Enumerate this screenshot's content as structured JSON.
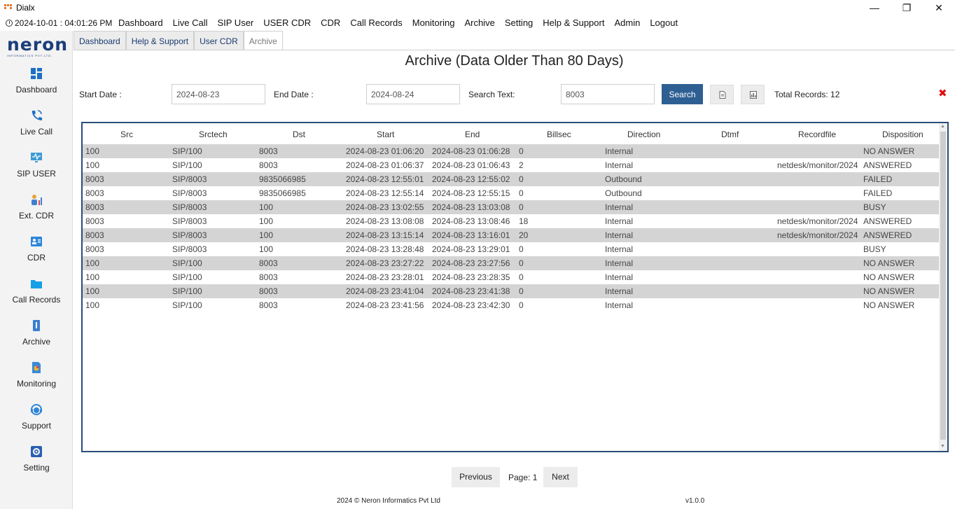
{
  "window": {
    "title": "Dialx",
    "minimize": "—",
    "maximize": "❐",
    "close": "✕"
  },
  "menubar": {
    "clock": "2024-10-01 : 04:01:26 PM",
    "items": [
      "Dashboard",
      "Live Call",
      "SIP User",
      "USER CDR",
      "CDR",
      "Call Records",
      "Monitoring",
      "Archive",
      "Setting",
      "Help & Support",
      "Admin",
      "Logout"
    ]
  },
  "logo": {
    "text": "neron",
    "sub": "INFORMATICS PVT.LTD."
  },
  "sidebar": {
    "items": [
      {
        "label": "Dashboard",
        "icon": "dashboard-icon"
      },
      {
        "label": "Live Call",
        "icon": "phone-icon"
      },
      {
        "label": "SIP USER",
        "icon": "monitor-pulse-icon"
      },
      {
        "label": "Ext. CDR",
        "icon": "users-chart-icon"
      },
      {
        "label": "CDR",
        "icon": "contacts-icon"
      },
      {
        "label": "Call Records",
        "icon": "folder-icon"
      },
      {
        "label": "Archive",
        "icon": "archive-icon"
      },
      {
        "label": "Monitoring",
        "icon": "report-icon"
      },
      {
        "label": "Support",
        "icon": "headset-icon"
      },
      {
        "label": "Setting",
        "icon": "gear-icon"
      }
    ]
  },
  "tabs": [
    "Dashboard",
    "Help & Support",
    "User CDR",
    "Archive"
  ],
  "page": {
    "title": "Archive (Data Older Than 80 Days)"
  },
  "filters": {
    "start_label": "Start Date :",
    "start_value": "2024-08-23",
    "end_label": "End Date :",
    "end_value": "2024-08-24",
    "search_label": "Search Text:",
    "search_value": "8003",
    "search_button": "Search",
    "total_records": "Total Records: 12",
    "close_symbol": "✖"
  },
  "table": {
    "columns": [
      "Src",
      "Srctech",
      "Dst",
      "Start",
      "End",
      "Billsec",
      "Direction",
      "Dtmf",
      "Recordfile",
      "Disposition"
    ],
    "rows": [
      [
        "100",
        "SIP/100",
        "8003",
        "2024-08-23 01:06:20",
        "2024-08-23 01:06:28",
        "0",
        "Internal",
        "",
        "",
        "NO ANSWER"
      ],
      [
        "100",
        "SIP/100",
        "8003",
        "2024-08-23 01:06:37",
        "2024-08-23 01:06:43",
        "2",
        "Internal",
        "",
        "netdesk/monitor/2024",
        "ANSWERED"
      ],
      [
        "8003",
        "SIP/8003",
        "9835066985",
        "2024-08-23 12:55:01",
        "2024-08-23 12:55:02",
        "0",
        "Outbound",
        "",
        "",
        "FAILED"
      ],
      [
        "8003",
        "SIP/8003",
        "9835066985",
        "2024-08-23 12:55:14",
        "2024-08-23 12:55:15",
        "0",
        "Outbound",
        "",
        "",
        "FAILED"
      ],
      [
        "8003",
        "SIP/8003",
        "100",
        "2024-08-23 13:02:55",
        "2024-08-23 13:03:08",
        "0",
        "Internal",
        "",
        "",
        "BUSY"
      ],
      [
        "8003",
        "SIP/8003",
        "100",
        "2024-08-23 13:08:08",
        "2024-08-23 13:08:46",
        "18",
        "Internal",
        "",
        "netdesk/monitor/2024",
        "ANSWERED"
      ],
      [
        "8003",
        "SIP/8003",
        "100",
        "2024-08-23 13:15:14",
        "2024-08-23 13:16:01",
        "20",
        "Internal",
        "",
        "netdesk/monitor/2024",
        "ANSWERED"
      ],
      [
        "8003",
        "SIP/8003",
        "100",
        "2024-08-23 13:28:48",
        "2024-08-23 13:29:01",
        "0",
        "Internal",
        "",
        "",
        "BUSY"
      ],
      [
        "100",
        "SIP/100",
        "8003",
        "2024-08-23 23:27:22",
        "2024-08-23 23:27:56",
        "0",
        "Internal",
        "",
        "",
        "NO ANSWER"
      ],
      [
        "100",
        "SIP/100",
        "8003",
        "2024-08-23 23:28:01",
        "2024-08-23 23:28:35",
        "0",
        "Internal",
        "",
        "",
        "NO ANSWER"
      ],
      [
        "100",
        "SIP/100",
        "8003",
        "2024-08-23 23:41:04",
        "2024-08-23 23:41:38",
        "0",
        "Internal",
        "",
        "",
        "NO ANSWER"
      ],
      [
        "100",
        "SIP/100",
        "8003",
        "2024-08-23 23:41:56",
        "2024-08-23 23:42:30",
        "0",
        "Internal",
        "",
        "",
        "NO ANSWER"
      ]
    ]
  },
  "pager": {
    "previous": "Previous",
    "page": "Page: 1",
    "next": "Next"
  },
  "footer": {
    "copyright": "2024 © Neron Informatics Pvt Ltd",
    "version": "v1.0.0"
  },
  "colors": {
    "accent": "#2e5f93",
    "row_shade": "#d4d4d4",
    "grid_border": "#2a4d7a",
    "close": "#e01010"
  }
}
